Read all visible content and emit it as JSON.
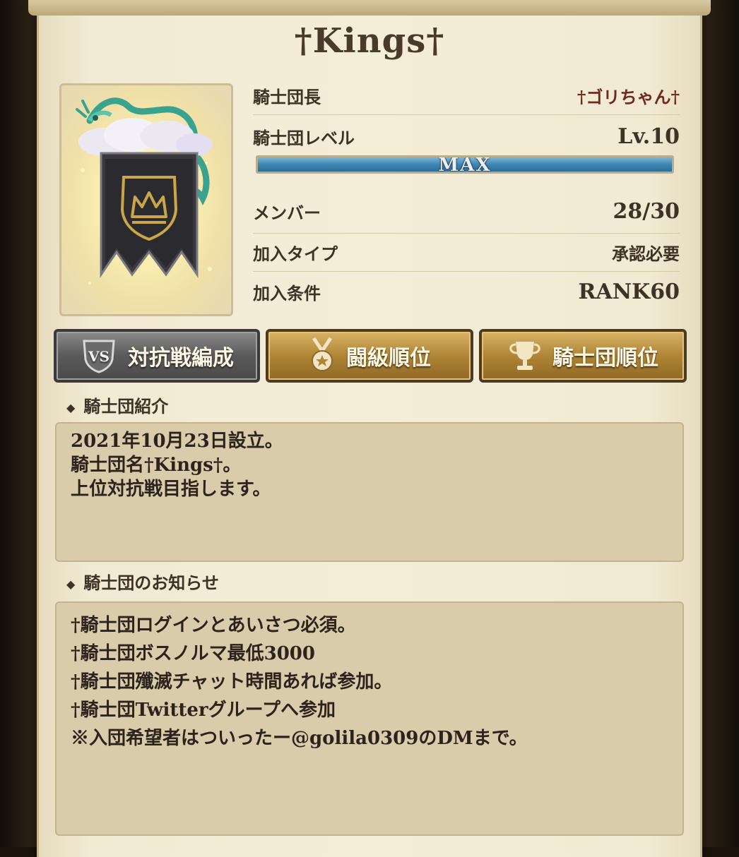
{
  "guild": {
    "title": "†Kings†",
    "leader_label": "騎士団長",
    "leader_value": "†ゴリちゃん†",
    "level_label": "騎士団レベル",
    "level_value": "Lv.10",
    "xp_text": "MAX",
    "xp_progress": 1.0,
    "members_label": "メンバー",
    "members_value": "28/30",
    "join_type_label": "加入タイプ",
    "join_type_value": "承認必要",
    "join_cond_label": "加入条件",
    "join_cond_value": "RANK60"
  },
  "buttons": {
    "vs_label": "対抗戦編成",
    "rank_label": "闘級順位",
    "guild_rank_label": "騎士団順位"
  },
  "intro": {
    "heading": "騎士団紹介",
    "lines": [
      "2021年10月23日設立。",
      "騎士団名†Kings†。",
      "上位対抗戦目指します。"
    ]
  },
  "notice": {
    "heading": "騎士団のお知らせ",
    "lines": [
      "†騎士団ログインとあいさつ必須。",
      "†騎士団ボスノルマ最低3000",
      "†騎士団殲滅チャット時間あれば参加。",
      "†騎士団Twitterグループへ参加",
      "※入団希望者はついったー@golila0309のDMまで。"
    ]
  },
  "colors": {
    "panel": "#f4edd8",
    "accent_gold": "#b08535",
    "xp_bar": "#3e86b4",
    "leader_name": "#6e2a1e"
  },
  "icons": [
    "vs-icon",
    "medal-icon",
    "trophy-icon",
    "dragon-banner-emblem",
    "crown-icon",
    "diamond-bullet-icon"
  ]
}
